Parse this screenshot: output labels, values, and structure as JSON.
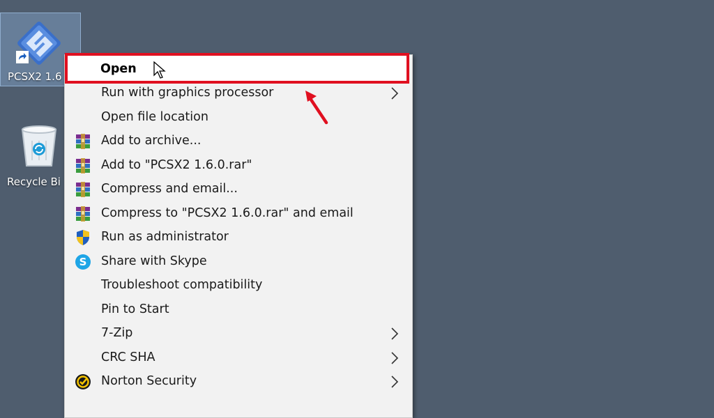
{
  "desktop": {
    "icons": [
      {
        "label": "PCSX2 1.6",
        "icon": "pcsx2-logo-icon"
      },
      {
        "label": "Recycle Bi",
        "icon": "recycle-bin-icon"
      }
    ]
  },
  "context_menu": {
    "items": [
      {
        "label": "Open",
        "icon": "",
        "submenu": false
      },
      {
        "label": "Run with graphics processor",
        "icon": "",
        "submenu": true
      },
      {
        "label": "Open file location",
        "icon": "",
        "submenu": false
      },
      {
        "label": "Add to archive...",
        "icon": "winrar-icon",
        "submenu": false
      },
      {
        "label": "Add to \"PCSX2 1.6.0.rar\"",
        "icon": "winrar-icon",
        "submenu": false
      },
      {
        "label": "Compress and email...",
        "icon": "winrar-icon",
        "submenu": false
      },
      {
        "label": "Compress to \"PCSX2 1.6.0.rar\" and email",
        "icon": "winrar-icon",
        "submenu": false
      },
      {
        "label": "Run as administrator",
        "icon": "uac-shield-icon",
        "submenu": false
      },
      {
        "label": "Share with Skype",
        "icon": "skype-icon",
        "submenu": false
      },
      {
        "label": "Troubleshoot compatibility",
        "icon": "",
        "submenu": false
      },
      {
        "label": "Pin to Start",
        "icon": "",
        "submenu": false
      },
      {
        "label": "7-Zip",
        "icon": "",
        "submenu": true
      },
      {
        "label": "CRC SHA",
        "icon": "",
        "submenu": true
      },
      {
        "label": "Norton Security",
        "icon": "norton-icon",
        "submenu": true
      }
    ]
  },
  "annotation": {
    "highlight_color": "#e01020",
    "arrow_color": "#e01020"
  },
  "colors": {
    "desktop_bg": "#4f5d6e",
    "menu_bg": "#f2f2f2"
  }
}
